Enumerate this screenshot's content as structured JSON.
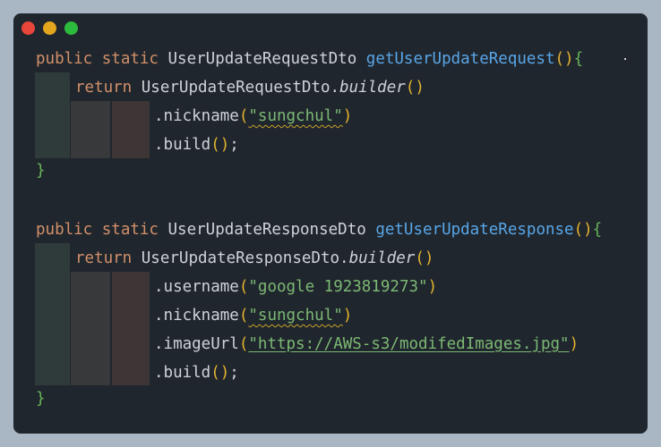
{
  "window": {
    "controls": [
      "close",
      "minimize",
      "maximize"
    ]
  },
  "code": {
    "block1": {
      "modifiers": "public static",
      "return_type": "UserUpdateRequestDto",
      "method_name": "getUserUpdateRequest",
      "open": "(){",
      "return_kw": "return",
      "builder_class": "UserUpdateRequestDto.",
      "builder_call": "builder",
      "builder_parens": "()",
      "calls": [
        {
          "method": ".nickname",
          "open": "(",
          "arg": "\"sungchul\"",
          "close": ")"
        },
        {
          "method": ".build",
          "open": "()",
          "arg": "",
          "close": ";"
        }
      ],
      "close_brace": "}"
    },
    "block2": {
      "modifiers": "public static",
      "return_type": "UserUpdateResponseDto",
      "method_name": "getUserUpdateResponse",
      "open": "(){",
      "return_kw": "return",
      "builder_class": "UserUpdateResponseDto.",
      "builder_call": "builder",
      "builder_parens": "()",
      "calls": [
        {
          "method": ".username",
          "open": "(",
          "arg": "\"google 1923819273\"",
          "close": ")"
        },
        {
          "method": ".nickname",
          "open": "(",
          "arg": "\"sungchul\"",
          "close": ")"
        },
        {
          "method": ".imageUrl",
          "open": "(",
          "arg": "\"https://AWS-s3/modifedImages.jpg\"",
          "close": ")"
        },
        {
          "method": ".build",
          "open": "()",
          "arg": "",
          "close": ";"
        }
      ],
      "close_brace": "}"
    }
  },
  "colors": {
    "background": "#20262d",
    "keyword": "#d2906a",
    "function": "#58a6e8",
    "paren": "#e4b431",
    "brace": "#67b55a",
    "string": "#7cb874"
  }
}
